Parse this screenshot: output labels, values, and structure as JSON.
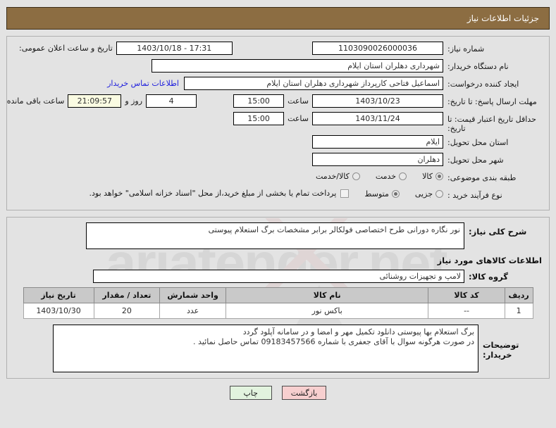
{
  "header": {
    "title": "جزئیات اطلاعات نیاز"
  },
  "form": {
    "need_number_label": "شماره نیاز:",
    "need_number_value": "1103090026000036",
    "public_announce_label": "تاریخ و ساعت اعلان عمومی:",
    "public_announce_value": "1403/10/18 - 17:31",
    "buyer_org_label": "نام دستگاه خریدار:",
    "buyer_org_value": "شهرداری دهلران استان ایلام",
    "creator_label": "ایجاد کننده درخواست:",
    "creator_value": "اسماعیل فتاحی کارپرداز شهرداری دهلران استان ایلام",
    "contact_link": "اطلاعات تماس خریدار",
    "response_deadline_label": "مهلت ارسال پاسخ: تا تاریخ:",
    "response_deadline_date": "1403/10/23",
    "response_deadline_time": "15:00",
    "time_word": "ساعت",
    "days_remaining": "4",
    "days_word": "روز و",
    "countdown": "21:09:57",
    "countdown_suffix": "ساعت باقی مانده",
    "price_validity_label": "حداقل تاریخ اعتبار قیمت: تا تاریخ:",
    "price_validity_date": "1403/11/24",
    "price_validity_time": "15:00",
    "province_label": "استان محل تحویل:",
    "province_value": "ایلام",
    "city_label": "شهر محل تحویل:",
    "city_value": "دهلران",
    "category_label": "طبقه بندی موضوعی:",
    "category_options": [
      {
        "label": "کالا",
        "selected": true
      },
      {
        "label": "خدمت",
        "selected": false
      },
      {
        "label": "کالا/خدمت",
        "selected": false
      }
    ],
    "process_label": "نوع فرآیند خرید :",
    "process_options": [
      {
        "label": "جزیی",
        "selected": false
      },
      {
        "label": "متوسط",
        "selected": true
      }
    ],
    "treasury_checkbox_text": "پرداخت تمام یا بخشی از مبلغ خرید،از محل \"اسناد خزانه اسلامی\" خواهد بود.",
    "treasury_checked": false
  },
  "description": {
    "label": "شرح کلی نیاز:",
    "value": "نور نگاره دورانی طرح اختصاصی فولکالر برابر مشخصات برگ استعلام پیوستی"
  },
  "goods_section": {
    "title": "اطلاعات کالاهای مورد نیاز",
    "group_label": "گروه کالا:",
    "group_value": "لامپ و تجهیزات روشنائی",
    "columns": [
      "ردیف",
      "کد کالا",
      "نام کالا",
      "واحد شمارش",
      "تعداد / مقدار",
      "تاریخ نیاز"
    ],
    "rows": [
      {
        "row": "1",
        "code": "--",
        "name": "باکس نور",
        "unit": "عدد",
        "qty": "20",
        "date": "1403/10/30"
      }
    ]
  },
  "notes": {
    "label": "توضیحات خریدار:",
    "value": "برگ استعلام بها پیوستی دانلود تکمیل مهر و امضا و در سامانه آپلود گردد\nدر صورت هرگونه سوال با آقای جعفری با شماره 09183457566 تماس حاصل نمائید ."
  },
  "footer": {
    "back_label": "بازگشت",
    "print_label": "چاپ"
  },
  "watermark": {
    "text": "ariatender.net"
  }
}
